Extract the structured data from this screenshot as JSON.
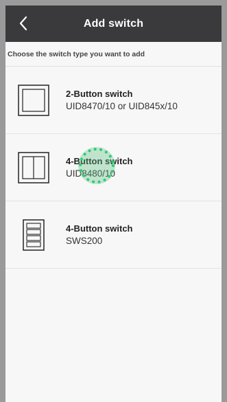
{
  "header": {
    "title": "Add switch",
    "back_icon": "chevron-left-icon"
  },
  "subheader": {
    "text": "Choose the switch type you want to add"
  },
  "switches": [
    {
      "name": "2-Button switch",
      "model": "UID8470/10 or UID845x/10",
      "icon": "2-button-switch-icon"
    },
    {
      "name": "4-Button switch",
      "model": "UID8480/10",
      "icon": "4-button-switch-icon"
    },
    {
      "name": "4-Button switch",
      "model": "SWS200",
      "icon": "4-button-vertical-switch-icon"
    }
  ],
  "colors": {
    "topbar": "#3a3a3c",
    "touch_indicator": "#2ecc71"
  }
}
